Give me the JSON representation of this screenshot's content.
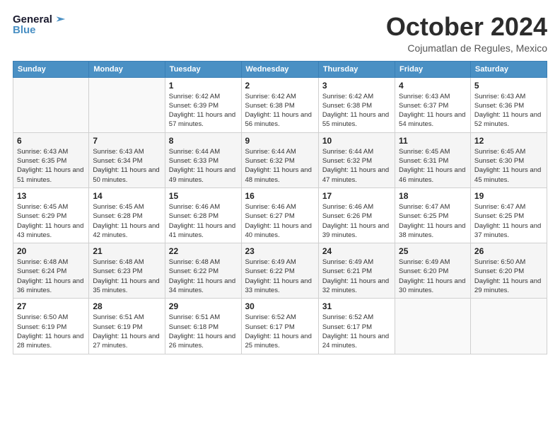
{
  "header": {
    "logo_line1": "General",
    "logo_line2": "Blue",
    "month": "October 2024",
    "location": "Cojumatlan de Regules, Mexico"
  },
  "weekdays": [
    "Sunday",
    "Monday",
    "Tuesday",
    "Wednesday",
    "Thursday",
    "Friday",
    "Saturday"
  ],
  "weeks": [
    [
      {
        "day": "",
        "info": ""
      },
      {
        "day": "",
        "info": ""
      },
      {
        "day": "1",
        "info": "Sunrise: 6:42 AM\nSunset: 6:39 PM\nDaylight: 11 hours and 57 minutes."
      },
      {
        "day": "2",
        "info": "Sunrise: 6:42 AM\nSunset: 6:38 PM\nDaylight: 11 hours and 56 minutes."
      },
      {
        "day": "3",
        "info": "Sunrise: 6:42 AM\nSunset: 6:38 PM\nDaylight: 11 hours and 55 minutes."
      },
      {
        "day": "4",
        "info": "Sunrise: 6:43 AM\nSunset: 6:37 PM\nDaylight: 11 hours and 54 minutes."
      },
      {
        "day": "5",
        "info": "Sunrise: 6:43 AM\nSunset: 6:36 PM\nDaylight: 11 hours and 52 minutes."
      }
    ],
    [
      {
        "day": "6",
        "info": "Sunrise: 6:43 AM\nSunset: 6:35 PM\nDaylight: 11 hours and 51 minutes."
      },
      {
        "day": "7",
        "info": "Sunrise: 6:43 AM\nSunset: 6:34 PM\nDaylight: 11 hours and 50 minutes."
      },
      {
        "day": "8",
        "info": "Sunrise: 6:44 AM\nSunset: 6:33 PM\nDaylight: 11 hours and 49 minutes."
      },
      {
        "day": "9",
        "info": "Sunrise: 6:44 AM\nSunset: 6:32 PM\nDaylight: 11 hours and 48 minutes."
      },
      {
        "day": "10",
        "info": "Sunrise: 6:44 AM\nSunset: 6:32 PM\nDaylight: 11 hours and 47 minutes."
      },
      {
        "day": "11",
        "info": "Sunrise: 6:45 AM\nSunset: 6:31 PM\nDaylight: 11 hours and 46 minutes."
      },
      {
        "day": "12",
        "info": "Sunrise: 6:45 AM\nSunset: 6:30 PM\nDaylight: 11 hours and 45 minutes."
      }
    ],
    [
      {
        "day": "13",
        "info": "Sunrise: 6:45 AM\nSunset: 6:29 PM\nDaylight: 11 hours and 43 minutes."
      },
      {
        "day": "14",
        "info": "Sunrise: 6:45 AM\nSunset: 6:28 PM\nDaylight: 11 hours and 42 minutes."
      },
      {
        "day": "15",
        "info": "Sunrise: 6:46 AM\nSunset: 6:28 PM\nDaylight: 11 hours and 41 minutes."
      },
      {
        "day": "16",
        "info": "Sunrise: 6:46 AM\nSunset: 6:27 PM\nDaylight: 11 hours and 40 minutes."
      },
      {
        "day": "17",
        "info": "Sunrise: 6:46 AM\nSunset: 6:26 PM\nDaylight: 11 hours and 39 minutes."
      },
      {
        "day": "18",
        "info": "Sunrise: 6:47 AM\nSunset: 6:25 PM\nDaylight: 11 hours and 38 minutes."
      },
      {
        "day": "19",
        "info": "Sunrise: 6:47 AM\nSunset: 6:25 PM\nDaylight: 11 hours and 37 minutes."
      }
    ],
    [
      {
        "day": "20",
        "info": "Sunrise: 6:48 AM\nSunset: 6:24 PM\nDaylight: 11 hours and 36 minutes."
      },
      {
        "day": "21",
        "info": "Sunrise: 6:48 AM\nSunset: 6:23 PM\nDaylight: 11 hours and 35 minutes."
      },
      {
        "day": "22",
        "info": "Sunrise: 6:48 AM\nSunset: 6:22 PM\nDaylight: 11 hours and 34 minutes."
      },
      {
        "day": "23",
        "info": "Sunrise: 6:49 AM\nSunset: 6:22 PM\nDaylight: 11 hours and 33 minutes."
      },
      {
        "day": "24",
        "info": "Sunrise: 6:49 AM\nSunset: 6:21 PM\nDaylight: 11 hours and 32 minutes."
      },
      {
        "day": "25",
        "info": "Sunrise: 6:49 AM\nSunset: 6:20 PM\nDaylight: 11 hours and 30 minutes."
      },
      {
        "day": "26",
        "info": "Sunrise: 6:50 AM\nSunset: 6:20 PM\nDaylight: 11 hours and 29 minutes."
      }
    ],
    [
      {
        "day": "27",
        "info": "Sunrise: 6:50 AM\nSunset: 6:19 PM\nDaylight: 11 hours and 28 minutes."
      },
      {
        "day": "28",
        "info": "Sunrise: 6:51 AM\nSunset: 6:19 PM\nDaylight: 11 hours and 27 minutes."
      },
      {
        "day": "29",
        "info": "Sunrise: 6:51 AM\nSunset: 6:18 PM\nDaylight: 11 hours and 26 minutes."
      },
      {
        "day": "30",
        "info": "Sunrise: 6:52 AM\nSunset: 6:17 PM\nDaylight: 11 hours and 25 minutes."
      },
      {
        "day": "31",
        "info": "Sunrise: 6:52 AM\nSunset: 6:17 PM\nDaylight: 11 hours and 24 minutes."
      },
      {
        "day": "",
        "info": ""
      },
      {
        "day": "",
        "info": ""
      }
    ]
  ]
}
